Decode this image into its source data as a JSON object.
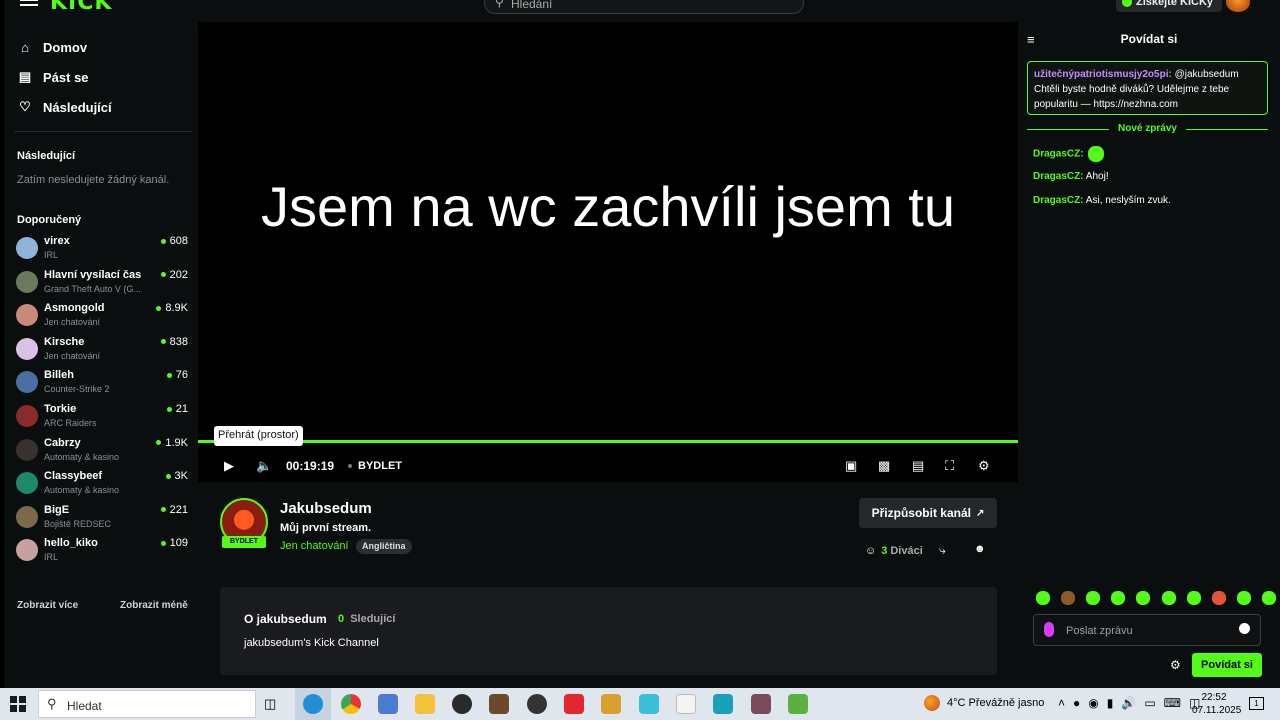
{
  "topbar": {
    "logo": "KICK",
    "search_placeholder": "Hledání",
    "kicks_label": "Získejte KICKy"
  },
  "sidebar": {
    "nav": [
      {
        "label": "Domov",
        "icon": "home-icon"
      },
      {
        "label": "Pást se",
        "icon": "browse-icon"
      },
      {
        "label": "Následující",
        "icon": "heart-icon"
      }
    ],
    "following_title": "Následující",
    "following_empty": "Zatím nesledujete žádný kanál.",
    "recommended_title": "Doporučený",
    "recommended": [
      {
        "name": "virex",
        "category": "IRL",
        "viewers": "608",
        "color": "#8fb3d9"
      },
      {
        "name": "Hlavní vysílací čas",
        "category": "Grand Theft Auto V (G...",
        "viewers": "202",
        "color": "#6b7a5c"
      },
      {
        "name": "Asmongold",
        "category": "Jen chatování",
        "viewers": "8.9K",
        "color": "#c98a7a"
      },
      {
        "name": "Kirsche",
        "category": "Jen chatování",
        "viewers": "838",
        "color": "#d9c2e6"
      },
      {
        "name": "Billeh",
        "category": "Counter-Strike 2",
        "viewers": "76",
        "color": "#4a6fa3"
      },
      {
        "name": "Torkie",
        "category": "ARC Raiders",
        "viewers": "21",
        "color": "#8a2a2a"
      },
      {
        "name": "Cabrzy",
        "category": "Automaty & kasino",
        "viewers": "1.9K",
        "color": "#3a3030"
      },
      {
        "name": "Classybeef",
        "category": "Automaty & kasino",
        "viewers": "3K",
        "color": "#1b8a6b"
      },
      {
        "name": "BigE",
        "category": "Bojiště REDSEC",
        "viewers": "221",
        "color": "#7a6a4a"
      },
      {
        "name": "hello_kiko",
        "category": "IRL",
        "viewers": "109",
        "color": "#c9a0a0"
      }
    ],
    "show_more": "Zobrazit více",
    "show_less": "Zobrazit méně"
  },
  "player": {
    "overlay_text": "Jsem na wc zachvíli jsem tu",
    "tooltip": "Přehrát (prostor)",
    "time": "00:19:19",
    "category_badge": "BYDLET",
    "progress": 1.0
  },
  "channel": {
    "name": "Jakubsedum",
    "avatar_badge": "BYDLET",
    "stream_title": "Můj první stream.",
    "category": "Jen chatování",
    "language_tag": "Angličtina",
    "customize_label": "Přizpůsobit kanál",
    "viewers_count": "3",
    "viewers_label": "Diváci"
  },
  "about": {
    "title": "O jakubsedum",
    "followers_count": "0",
    "followers_label": "Sledující",
    "description": "jakubsedum's Kick Channel"
  },
  "chat": {
    "title": "Povídat si",
    "pinned": {
      "user": "užitečnýpatriotismusjy2o5pi:",
      "text": " @jakubsedum Chtěli byste hodně diváků? Udělejme z tebe popularitu — https://nezhna.com"
    },
    "new_messages_label": "Nové zprávy",
    "messages": [
      {
        "user": "DragasCZ:",
        "text": "",
        "emote": true
      },
      {
        "user": "DragasCZ:",
        "text": " Ahoj!",
        "emote": false
      },
      {
        "user": "DragasCZ:",
        "text": " Asi, neslyším zvuk.",
        "emote": false
      }
    ],
    "input_placeholder": "Poslat zprávu",
    "send_label": "Povídat si"
  },
  "taskbar": {
    "search_placeholder": "Hledat",
    "weather": "4°C  Převážně jasno",
    "time": "22:52",
    "date": "07.11.2025",
    "notification_count": "1"
  }
}
